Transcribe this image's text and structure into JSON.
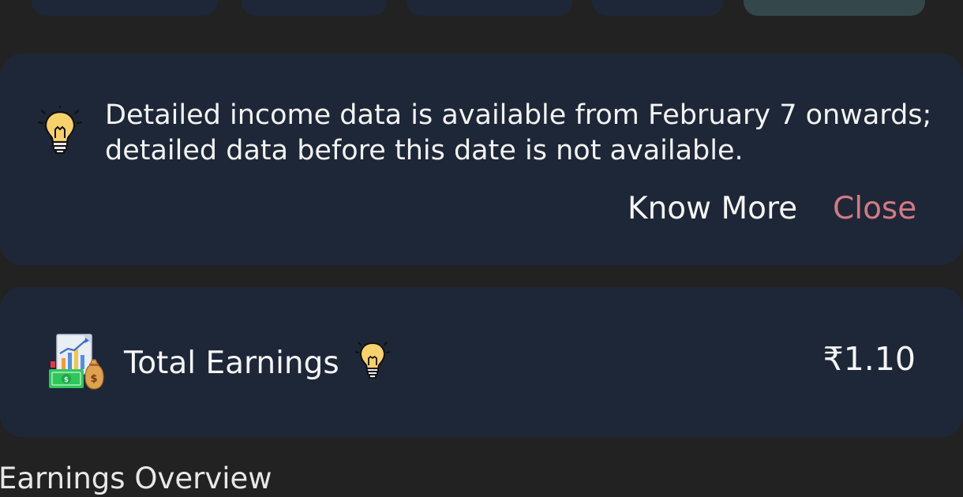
{
  "notice": {
    "line1": "Detailed income data is available from February 7 onwards;",
    "line2": "detailed data before this date is not available.",
    "know_more_label": "Know More",
    "close_label": "Close",
    "icon": "lightbulb-icon"
  },
  "earnings": {
    "label": "Total Earnings",
    "value": "₹1.10",
    "icon": "earnings-chart-money-icon",
    "info_icon": "lightbulb-icon"
  },
  "section": {
    "title": "Earnings Overview"
  },
  "colors": {
    "background": "#222222",
    "card": "#1e2737",
    "active_tab": "#34474a",
    "close_accent": "#d27a84",
    "text": "#f3f3f3"
  }
}
